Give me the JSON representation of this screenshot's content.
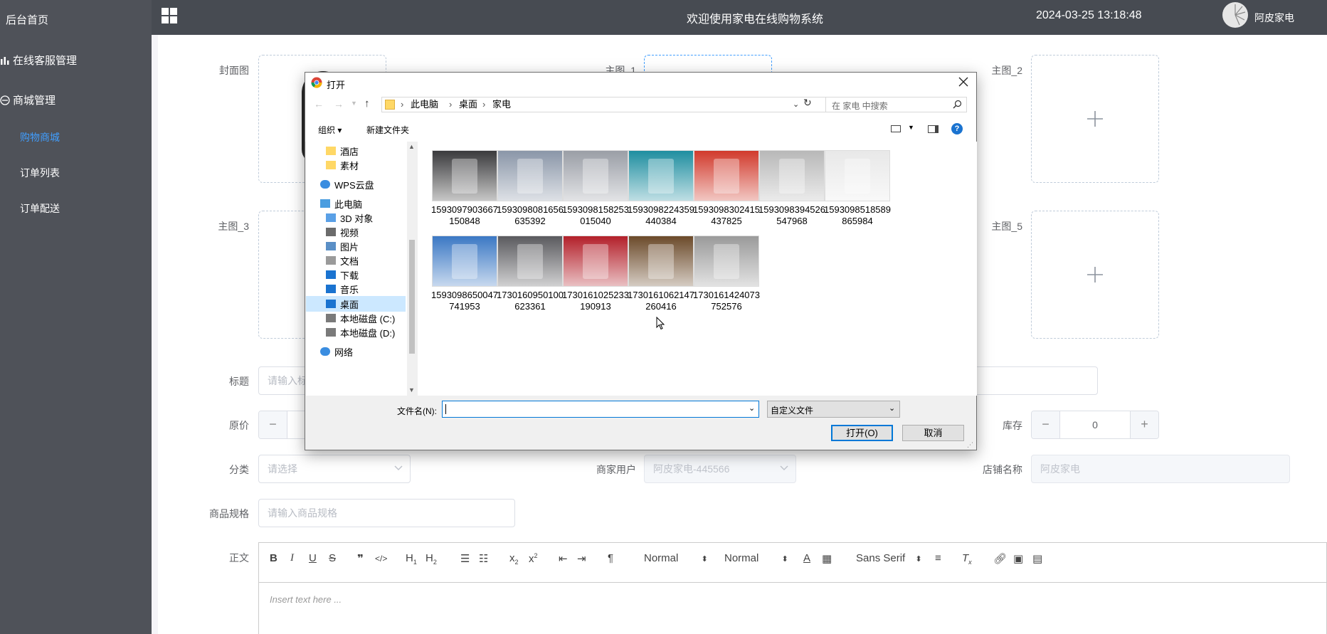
{
  "sidebar": {
    "home": "后台首页",
    "service": "在线客服管理",
    "shop": "商城管理",
    "sub_items": [
      "购物商城",
      "订单列表",
      "订单配送"
    ]
  },
  "topbar": {
    "title": "欢迎使用家电在线购物系统",
    "datetime": "2024-03-25 13:18:48",
    "username": "阿皮家电"
  },
  "form": {
    "cover_label": "封面图",
    "main1_label": "主图_1",
    "main2_label": "主图_2",
    "main3_label": "主图_3",
    "main5_label": "主图_5",
    "title_label": "标题",
    "title_placeholder": "请输入标",
    "price_label": "原价",
    "stock_label": "库存",
    "stock_value": "0",
    "category_label": "分类",
    "category_placeholder": "请选择",
    "merchant_label": "商家用户",
    "merchant_value": "阿皮家电-445566",
    "store_label": "店铺名称",
    "store_value": "阿皮家电",
    "spec_label": "商品规格",
    "spec_placeholder": "请输入商品规格",
    "body_label": "正文",
    "editor": {
      "size_select": "Normal",
      "header_select": "Normal",
      "font_select": "Sans Serif",
      "placeholder": "Insert text here ..."
    }
  },
  "dialog": {
    "title": "打开",
    "breadcrumb": [
      "此电脑",
      "桌面",
      "家电"
    ],
    "search_placeholder": "在 家电 中搜索",
    "organize": "组织",
    "new_folder": "新建文件夹",
    "nav_items": [
      {
        "label": "酒店",
        "icon": "folder-icon"
      },
      {
        "label": "素材",
        "icon": "folder-icon"
      },
      {
        "label": "WPS云盘",
        "icon": "cloud-icon"
      },
      {
        "label": "此电脑",
        "icon": "computer-icon"
      },
      {
        "label": "3D 对象",
        "icon": "cube-icon"
      },
      {
        "label": "视频",
        "icon": "video-icon"
      },
      {
        "label": "图片",
        "icon": "picture-icon"
      },
      {
        "label": "文档",
        "icon": "document-icon"
      },
      {
        "label": "下载",
        "icon": "download-icon"
      },
      {
        "label": "音乐",
        "icon": "music-icon"
      },
      {
        "label": "桌面",
        "icon": "desktop-icon"
      },
      {
        "label": "本地磁盘 (C:)",
        "icon": "drive-icon"
      },
      {
        "label": "本地磁盘 (D:)",
        "icon": "drive-icon"
      },
      {
        "label": "网络",
        "icon": "network-icon"
      }
    ],
    "files": [
      {
        "line1": "1593097903667",
        "line2": "150848",
        "color": "#3a3a3c"
      },
      {
        "line1": "1593098081656",
        "line2": "635392",
        "color": "#8a96a8"
      },
      {
        "line1": "1593098158253",
        "line2": "015040",
        "color": "#9a9ea6"
      },
      {
        "line1": "1593098224359",
        "line2": "440384",
        "color": "#1f8ea0"
      },
      {
        "line1": "1593098302415",
        "line2": "437825",
        "color": "#d13a2c"
      },
      {
        "line1": "1593098394526",
        "line2": "547968",
        "color": "#b8b8b8"
      },
      {
        "line1": "1593098518589",
        "line2": "865984",
        "color": "#e8e8e8"
      },
      {
        "line1": "1593098650047",
        "line2": "741953",
        "color": "#3b78c4"
      },
      {
        "line1": "1730160950100",
        "line2": "623361",
        "color": "#5a5a5e"
      },
      {
        "line1": "1730161025233",
        "line2": "190913",
        "color": "#b3202a"
      },
      {
        "line1": "1730161062147",
        "line2": "260416",
        "color": "#6b4a2a"
      },
      {
        "line1": "1730161424073",
        "line2": "752576",
        "color": "#9a9a9a"
      }
    ],
    "filename_label": "文件名(N):",
    "filetype": "自定义文件",
    "open_button": "打开(O)",
    "cancel_button": "取消"
  }
}
